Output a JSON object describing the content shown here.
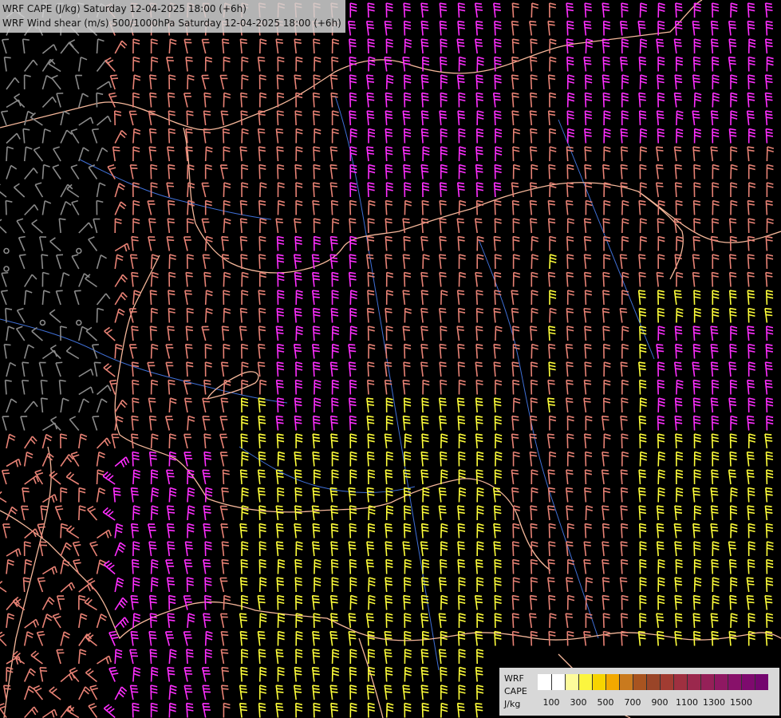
{
  "titles": {
    "line1": "WRF CAPE (J/kg) Saturday 12-04-2025 18:00 (+6h)",
    "line2": "WRF Wind shear (m/s) 500/1000hPa Saturday 12-04-2025 18:00 (+6h)"
  },
  "legend": {
    "model": "WRF",
    "field": "CAPE",
    "unit": "J/kg",
    "colors": [
      "#ffffff",
      "#ffffff",
      "#fdfb9b",
      "#fbf53f",
      "#f7d400",
      "#f2a900",
      "#c97a1e",
      "#a85420",
      "#9a4528",
      "#a13c32",
      "#9f3040",
      "#9b284d",
      "#952058",
      "#8f1862",
      "#88116a",
      "#7e0a6e",
      "#74066f"
    ],
    "ticks": [
      "100",
      "300",
      "500",
      "700",
      "900",
      "1100",
      "1300",
      "1500"
    ]
  },
  "palette": {
    "background": "#000000",
    "border": "#f5b79a",
    "river": "#3f6fd6",
    "barb_grey": "#8a8a8a",
    "barb_salmon": "#e88275",
    "barb_magenta": "#ff2eff",
    "barb_yellow": "#ffff3a"
  },
  "icons": {
    "wind_barb": "wind-barb-icon",
    "calm_circle": "calm-circle-icon"
  }
}
